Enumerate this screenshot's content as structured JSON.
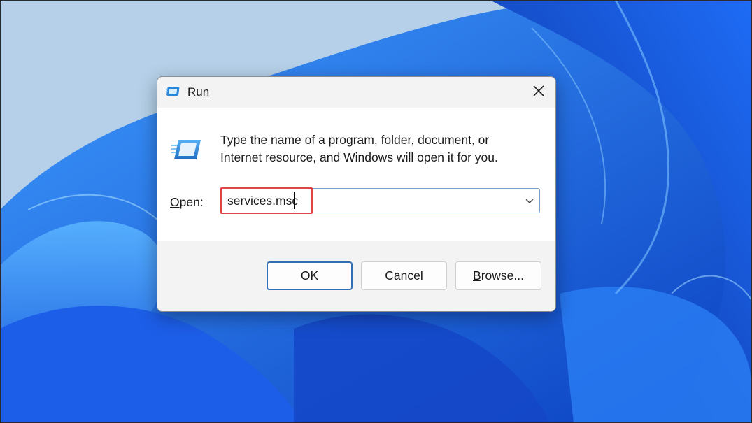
{
  "window": {
    "title": "Run"
  },
  "dialog": {
    "description_line1": "Type the name of a program, folder, document, or",
    "description_line2": "Internet resource, and Windows will open it for you.",
    "open_label_first": "O",
    "open_label_rest": "pen:",
    "open_value": "services.msc"
  },
  "buttons": {
    "ok": "OK",
    "cancel": "Cancel",
    "browse_first": "B",
    "browse_rest": "rowse..."
  },
  "icons": {
    "title_icon": "run-icon",
    "dialog_icon": "run-icon",
    "close": "close-icon",
    "dropdown": "chevron-down-icon"
  },
  "colors": {
    "highlight_border": "#e04545",
    "primary_button_border": "#2f6fb2",
    "wallpaper_blue": "#1a6cf0"
  }
}
